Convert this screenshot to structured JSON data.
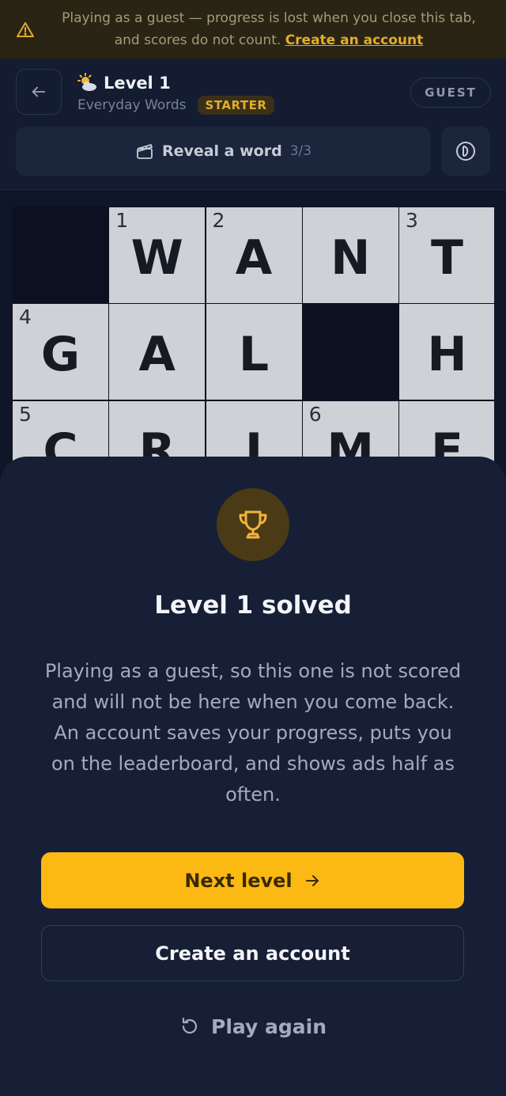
{
  "banner": {
    "text": "Playing as a guest — progress is lost when you close this tab, and scores do not count.",
    "link": "Create an account",
    "icon": "warning-icon"
  },
  "header": {
    "level_title": "Level 1",
    "category": "Everyday Words",
    "badge": "STARTER",
    "guest_label": "GUEST",
    "reveal_label": "Reveal a word",
    "reveal_count": "3/3"
  },
  "grid": {
    "rows": [
      [
        {
          "black": true
        },
        {
          "num": "1",
          "letter": "W"
        },
        {
          "num": "2",
          "letter": "A"
        },
        {
          "letter": "N"
        },
        {
          "num": "3",
          "letter": "T"
        }
      ],
      [
        {
          "num": "4",
          "letter": "G"
        },
        {
          "letter": "A"
        },
        {
          "letter": "L"
        },
        {
          "black": true
        },
        {
          "letter": "H"
        }
      ],
      [
        {
          "num": "5",
          "letter": "C"
        },
        {
          "letter": "R"
        },
        {
          "letter": "I"
        },
        {
          "num": "6",
          "letter": "M"
        },
        {
          "letter": "E"
        }
      ]
    ]
  },
  "sheet": {
    "title": "Level 1 solved",
    "body": "Playing as a guest, so this one is not scored and will not be here when you come back. An account saves your progress, puts you on the leaderboard, and shows ads half as often.",
    "next_label": "Next level",
    "account_label": "Create an account",
    "replay_label": "Play again"
  },
  "colors": {
    "accent": "#fdb913",
    "banner_link": "#e1ad2b",
    "sheet_bg": "#161f35"
  }
}
